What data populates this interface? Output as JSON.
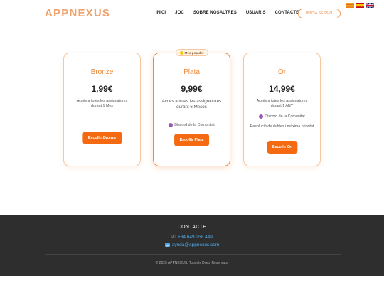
{
  "header": {
    "logo": "APPNEXUS",
    "nav": [
      "INICI",
      "JOC",
      "SOBRE NOSALTRES",
      "USUARIS",
      "CONTACTE"
    ],
    "login_label": "INICIA SESSIÓ",
    "flags": [
      "catalan-flag-icon",
      "spanish-flag-icon",
      "uk-flag-icon"
    ]
  },
  "plans": [
    {
      "name": "Bronze",
      "price": "1,99€",
      "desc": "Accés a totes les assignatures durant 1 Mes",
      "features": [],
      "button": "Escollir Bronze"
    },
    {
      "name": "Plata",
      "price": "9,99€",
      "desc": "Accés a totes les assignatures durant 6 Mesos",
      "badge": "Més popular",
      "features": [
        "Discord de la Comunitat"
      ],
      "button": "Escollir Plata"
    },
    {
      "name": "Or",
      "price": "14,99€",
      "desc": "Accés a totes les assignatures durant 1 ANY",
      "features": [
        "Discord de la Comunitat"
      ],
      "extra": "Resolució de dubtes i màxima prioritat",
      "button": "Escollir Or"
    }
  ],
  "footer": {
    "title": "CONTACTE",
    "phone": "+34 649 258 449",
    "email": "ayuda@appnexus.com",
    "copyright": "© 2025 APPNEXUS. Tots els Drets Reservats."
  },
  "colors": {
    "accent": "#f56a10",
    "accent_light": "#f08a3a",
    "footer_bg": "#2e2e2e",
    "link": "#4fa8e8",
    "discord": "#9b59b6"
  }
}
